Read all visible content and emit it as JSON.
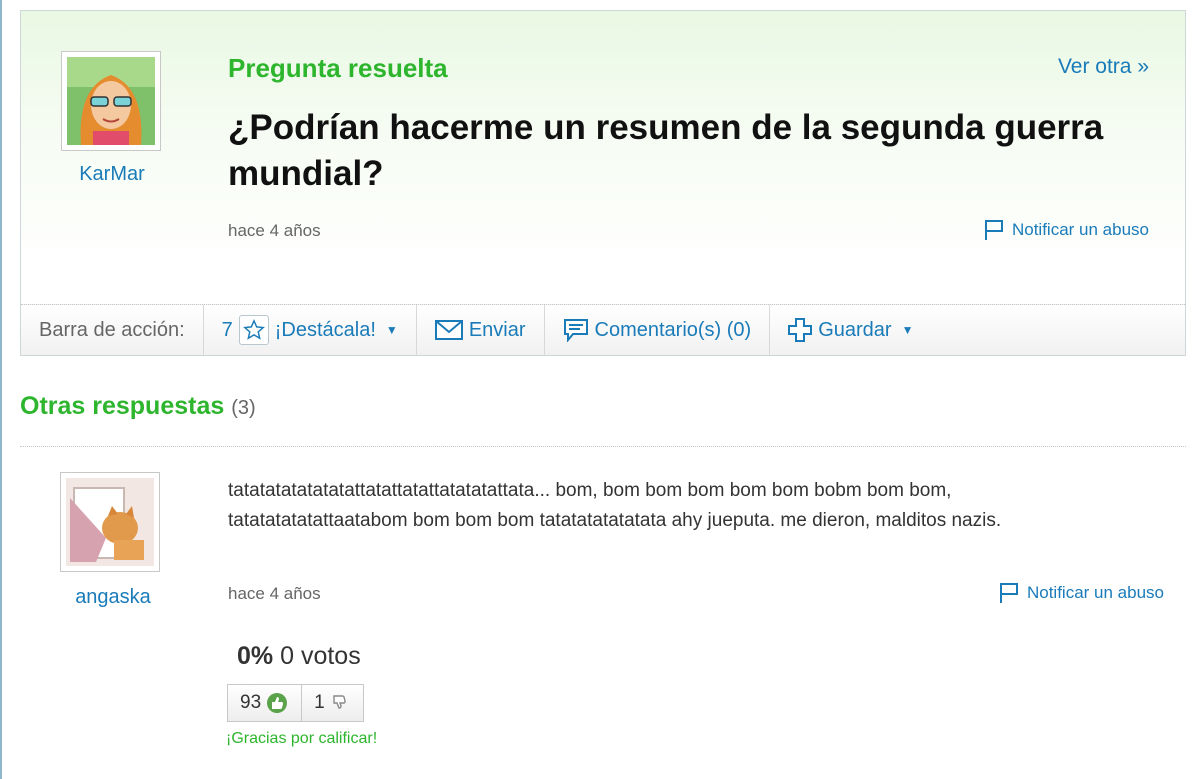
{
  "question": {
    "status": "Pregunta resuelta",
    "next_link": "Ver otra »",
    "title": "¿Podrían hacerme un resumen de la segunda guerra mundial?",
    "author": "KarMar",
    "time": "hace 4 años",
    "report": "Notificar un abuso"
  },
  "action_bar": {
    "label": "Barra de acción:",
    "star_count": "7",
    "highlight": "¡Destácala!",
    "send": "Enviar",
    "comments": "Comentario(s) (0)",
    "save": "Guardar"
  },
  "other_answers": {
    "title": "Otras respuestas",
    "count": "(3)",
    "items": [
      {
        "author": "angaska",
        "text": "tatatatatatatatattatattatattatatatattata... bom, bom bom bom bom bom bobm bom bom, tatatatatatattaatabom bom bom bom tatatatatatatata ahy jueputa. me dieron, malditos nazis.",
        "time": "hace 4 años",
        "report": "Notificar un abuso",
        "percent": "0%",
        "votes": "0 votos",
        "thumbs_up": "93",
        "thumbs_down": "1",
        "thanks": "¡Gracias por calificar!"
      }
    ]
  },
  "icons": {
    "flag": "flag-icon",
    "star": "star-icon",
    "envelope": "envelope-icon",
    "comment": "comment-icon",
    "plus": "plus-icon",
    "thumbs_up": "thumbs-up-icon",
    "thumbs_down": "thumbs-down-icon"
  },
  "colors": {
    "accent_green": "#2db52d",
    "link_blue": "#1a7bb9"
  }
}
